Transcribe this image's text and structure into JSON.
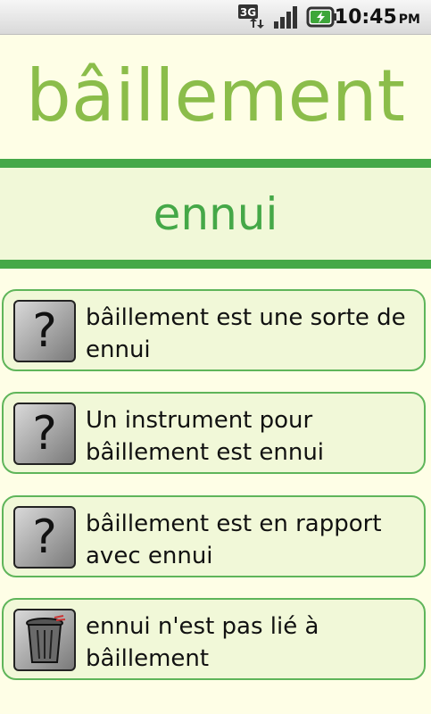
{
  "status_bar": {
    "network_label": "3G",
    "time": "10:45",
    "ampm": "PM"
  },
  "word": "bâillement",
  "related_word": "ennui",
  "relations": [
    {
      "icon": "question-icon",
      "icon_glyph": "?",
      "text": "bâillement est une sorte de ennui"
    },
    {
      "icon": "question-icon",
      "icon_glyph": "?",
      "text": "Un instrument pour bâillement est ennui"
    },
    {
      "icon": "question-icon",
      "icon_glyph": "?",
      "text": "bâillement est en rapport avec ennui"
    },
    {
      "icon": "trash-icon",
      "text": "ennui n'est pas lié à bâillement"
    }
  ],
  "colors": {
    "background": "#fefee6",
    "accent_light": "#8bbd4a",
    "accent": "#45a848",
    "card_background": "#f1f8d8"
  }
}
